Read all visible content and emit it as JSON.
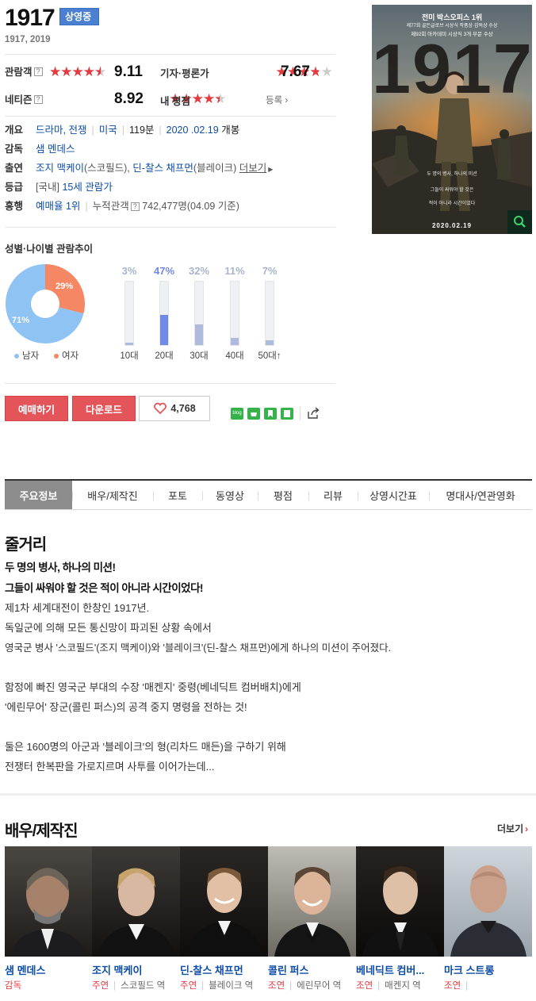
{
  "movie": {
    "title": "1917",
    "badge": "상영중",
    "subtitle": "1917, 2019"
  },
  "ratings": {
    "audience": {
      "label": "관람객",
      "score": "9.11",
      "stars": 0.911
    },
    "critic": {
      "label": "기자·평론가",
      "score": "7.67",
      "stars": 0.767
    },
    "netizen": {
      "label": "네티즌",
      "score": "8.92",
      "stars": 0.892
    },
    "mine": {
      "label": "내 평점",
      "action": "등록"
    }
  },
  "info": {
    "overview_label": "개요",
    "genre": "드라마, 전쟁",
    "country": "미국",
    "runtime": "119분",
    "release_date": "2020 .02.19",
    "release_suffix": "개봉",
    "director_label": "감독",
    "director": "샘 멘데스",
    "cast_label": "출연",
    "cast_1": "조지 맥케이",
    "cast_1_role": "(스코필드),",
    "cast_2": "딘-찰스 채프먼",
    "cast_2_role": "(블레이크)",
    "more": "더보기",
    "grade_label": "등급",
    "grade_prefix": "[국내]",
    "grade": "15세 관람가",
    "box_label": "흥행",
    "reserve": "예매율 1위",
    "cum_label": "누적관객",
    "cum_value": "742,477명(04.09 기준)"
  },
  "poster": {
    "line1": "전미 박스오피스 1위",
    "line2": "제77회 골든글로브 시상식 작품상·감독상 수상",
    "line3": "제92회 아카데미 시상식 3개 부문 수상",
    "big": "1917",
    "tag1": "두 명의 병사, 하나의 미션",
    "tag2": "그들이 싸워야 할 것은",
    "tag3": "적이 아니라 시간이었다",
    "date": "2020.02.19",
    "zoom_icon": "search-icon"
  },
  "demographics": {
    "title": "성별·나이별 관람추이",
    "male_pct": "71%",
    "female_pct": "29%",
    "male_label": "남자",
    "female_label": "여자",
    "male_share": 0.71,
    "female_share": 0.29,
    "male_color": "#8ec3f3",
    "female_color": "#f58764",
    "ages": [
      {
        "label": "10대",
        "pct": "3%",
        "value": 0.03
      },
      {
        "label": "20대",
        "pct": "47%",
        "value": 0.47
      },
      {
        "label": "30대",
        "pct": "32%",
        "value": 0.32
      },
      {
        "label": "40대",
        "pct": "11%",
        "value": 0.11
      },
      {
        "label": "50대↑",
        "pct": "7%",
        "value": 0.07
      }
    ],
    "highlight_color": "#7289e6"
  },
  "actions": {
    "reserve": "예매하기",
    "download": "다운로드",
    "likes": "4,768"
  },
  "tabs": [
    "주요정보",
    "배우/제작진",
    "포토",
    "동영상",
    "평점",
    "리뷰",
    "상영시간표",
    "명대사/연관영화"
  ],
  "synopsis": {
    "heading": "줄거리",
    "tagline1": "두 명의 병사, 하나의 미션!",
    "tagline2": "그들이 싸워야 할 것은 적이 아니라 시간이었다!",
    "lines": [
      "제1차 세계대전이 한창인 1917년.",
      " 독일군에 의해 모든 통신망이 파괴된 상황 속에서",
      " 영국군 병사 '스코필드'(조지 맥케이)와 '블레이크'(딘-찰스 채프먼)에게 하나의 미션이 주어졌다.",
      "",
      " 함정에 빠진 영국군 부대의 수장 '매켄지' 중령(베네딕트 컴버배치)에게",
      " '에린무어' 장군(콜린 퍼스)의 공격 중지 명령을 전하는 것!",
      "",
      " 둘은 1600명의 아군과 '블레이크'의 형(리차드 매든)을 구하기 위해",
      " 전쟁터 한복판을 가로지르며 사투를 이어가는데..."
    ]
  },
  "cast_section": {
    "heading": "배우/제작진",
    "more": "더보기",
    "people": [
      {
        "name": "샘 멘데스",
        "role": "감독",
        "character": ""
      },
      {
        "name": "조지 맥케이",
        "role": "주연",
        "character": "스코필드 역"
      },
      {
        "name": "딘-찰스 채프먼",
        "role": "주연",
        "character": "블레이크 역"
      },
      {
        "name": "콜린 퍼스",
        "role": "조연",
        "character": "에린무어 역"
      },
      {
        "name": "베네딕트 컴버...",
        "role": "조연",
        "character": "매켄지 역"
      },
      {
        "name": "마크 스트롱",
        "role": "조연",
        "character": ""
      }
    ]
  }
}
